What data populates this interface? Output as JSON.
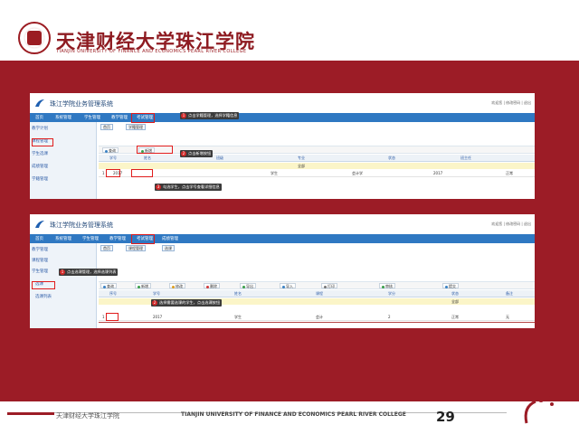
{
  "header": {
    "logo_cn": "天津财经大学珠江学院",
    "logo_en": "TIANJIN UNIVERSITY OF FINANCE AND ECONOMICS PEARL RIVER COLLEGE"
  },
  "footer": {
    "school_cn": "天津财经大学珠江学院",
    "school_en": "TIANJIN UNIVERSITY OF FINANCE AND ECONOMICS PEARL RIVER COLLEGE",
    "page_number": "29"
  },
  "shot1": {
    "app_title": "珠江学院业务管理系统",
    "top_links": "欢迎您 | 修改密码 | 退出",
    "menu": [
      "首页",
      "系统管理",
      "学生管理",
      "教学管理",
      "考试管理"
    ],
    "sidebar": [
      "教学计划",
      "课程管理",
      "学生选课",
      "成绩管理",
      "学籍管理"
    ],
    "tabs": [
      "首页",
      "学籍管理"
    ],
    "toolbar_buttons": [
      "查询",
      "新增"
    ],
    "columns": [
      "学号",
      "姓名",
      "班级",
      "专业",
      "状态",
      "班主任"
    ],
    "filter_value": "全部",
    "row": [
      "1",
      "2017",
      "学生",
      "会计学",
      "2017",
      "正常"
    ],
    "notes": [
      "点击学籍管理，选择学籍信息",
      "点击新增按钮",
      "勾选学生，点击学号查看详细信息"
    ]
  },
  "shot2": {
    "app_title": "珠江学院业务管理系统",
    "top_links": "欢迎您 | 修改密码 | 退出",
    "menu": [
      "首页",
      "系统管理",
      "学生管理",
      "教学管理",
      "考试管理",
      "成绩管理"
    ],
    "sidebar": [
      "教学管理",
      "课程管理",
      "学生管理",
      "选课",
      "选课列表"
    ],
    "tabs": [
      "首页",
      "课程管理",
      "选课"
    ],
    "toolbar_buttons": [
      "查询",
      "新增",
      "修改",
      "删除",
      "导出",
      "导入",
      "打印",
      "审核",
      "提交"
    ],
    "columns": [
      "序号",
      "学号",
      "姓名",
      "课程",
      "学分",
      "状态",
      "备注"
    ],
    "filter_value": "全部",
    "row": [
      "1",
      "2017",
      "学生",
      "会计",
      "2",
      "正常",
      "无"
    ],
    "notes": [
      "点击选课管理，选择选课列表",
      "选择需要选课的学生，点击选课按钮"
    ]
  },
  "colors": {
    "brand_red": "#9c1c26",
    "menu_blue": "#2f78c2",
    "highlight_red": "#e01c1c"
  }
}
